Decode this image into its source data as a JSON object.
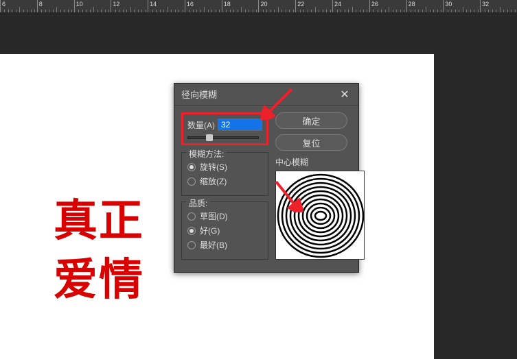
{
  "ruler": {
    "marks": [
      6,
      8,
      10,
      12,
      14,
      16,
      18,
      20,
      22,
      24,
      26,
      28,
      30,
      32
    ]
  },
  "canvas": {
    "text_line1": "真正",
    "text_line2": "爱情"
  },
  "dialog": {
    "title": "径向模糊",
    "buttons": {
      "ok": "确定",
      "reset": "复位"
    },
    "amount": {
      "label": "数量(A)",
      "value": "32",
      "slider_percent": 30
    },
    "method": {
      "title": "模糊方法:",
      "spin": "旋转(S)",
      "zoom": "缩放(Z)",
      "selected": "spin"
    },
    "quality": {
      "title": "品质:",
      "draft": "草图(D)",
      "good": "好(G)",
      "best": "最好(B)",
      "selected": "good"
    },
    "center_label": "中心模糊"
  }
}
